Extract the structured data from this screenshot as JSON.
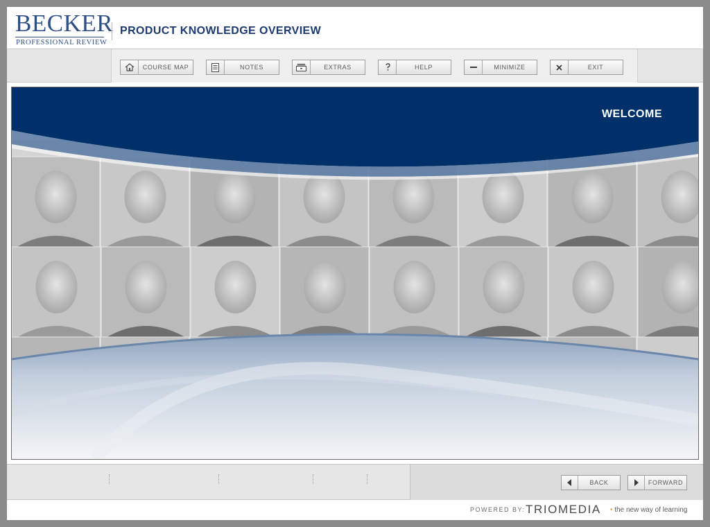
{
  "brand": {
    "logo_main": "BECKER",
    "logo_sub": "PROFESSIONAL REVIEW",
    "course_title": "PRODUCT KNOWLEDGE OVERVIEW"
  },
  "toolbar": {
    "course_map": "COURSE MAP",
    "notes": "NOTES",
    "extras": "EXTRAS",
    "help": "HELP",
    "minimize": "MINIMIZE",
    "exit": "EXIT"
  },
  "stage": {
    "heading": "WELCOME"
  },
  "nav": {
    "back": "BACK",
    "forward": "FORWARD"
  },
  "footer": {
    "powered_by": "POWERED BY:",
    "brand": "TRIOMEDIA",
    "tagline": "the new way of learning"
  },
  "colors": {
    "brand_navy": "#00306a",
    "logo_blue": "#2e4f86",
    "accent_orange": "#e0a24a"
  },
  "icons": {
    "course_map": "home-icon",
    "notes": "document-icon",
    "extras": "filing-cabinet-icon",
    "help": "question-icon",
    "minimize": "minus-icon",
    "exit": "close-icon",
    "back": "arrow-left-icon",
    "forward": "arrow-right-icon"
  }
}
